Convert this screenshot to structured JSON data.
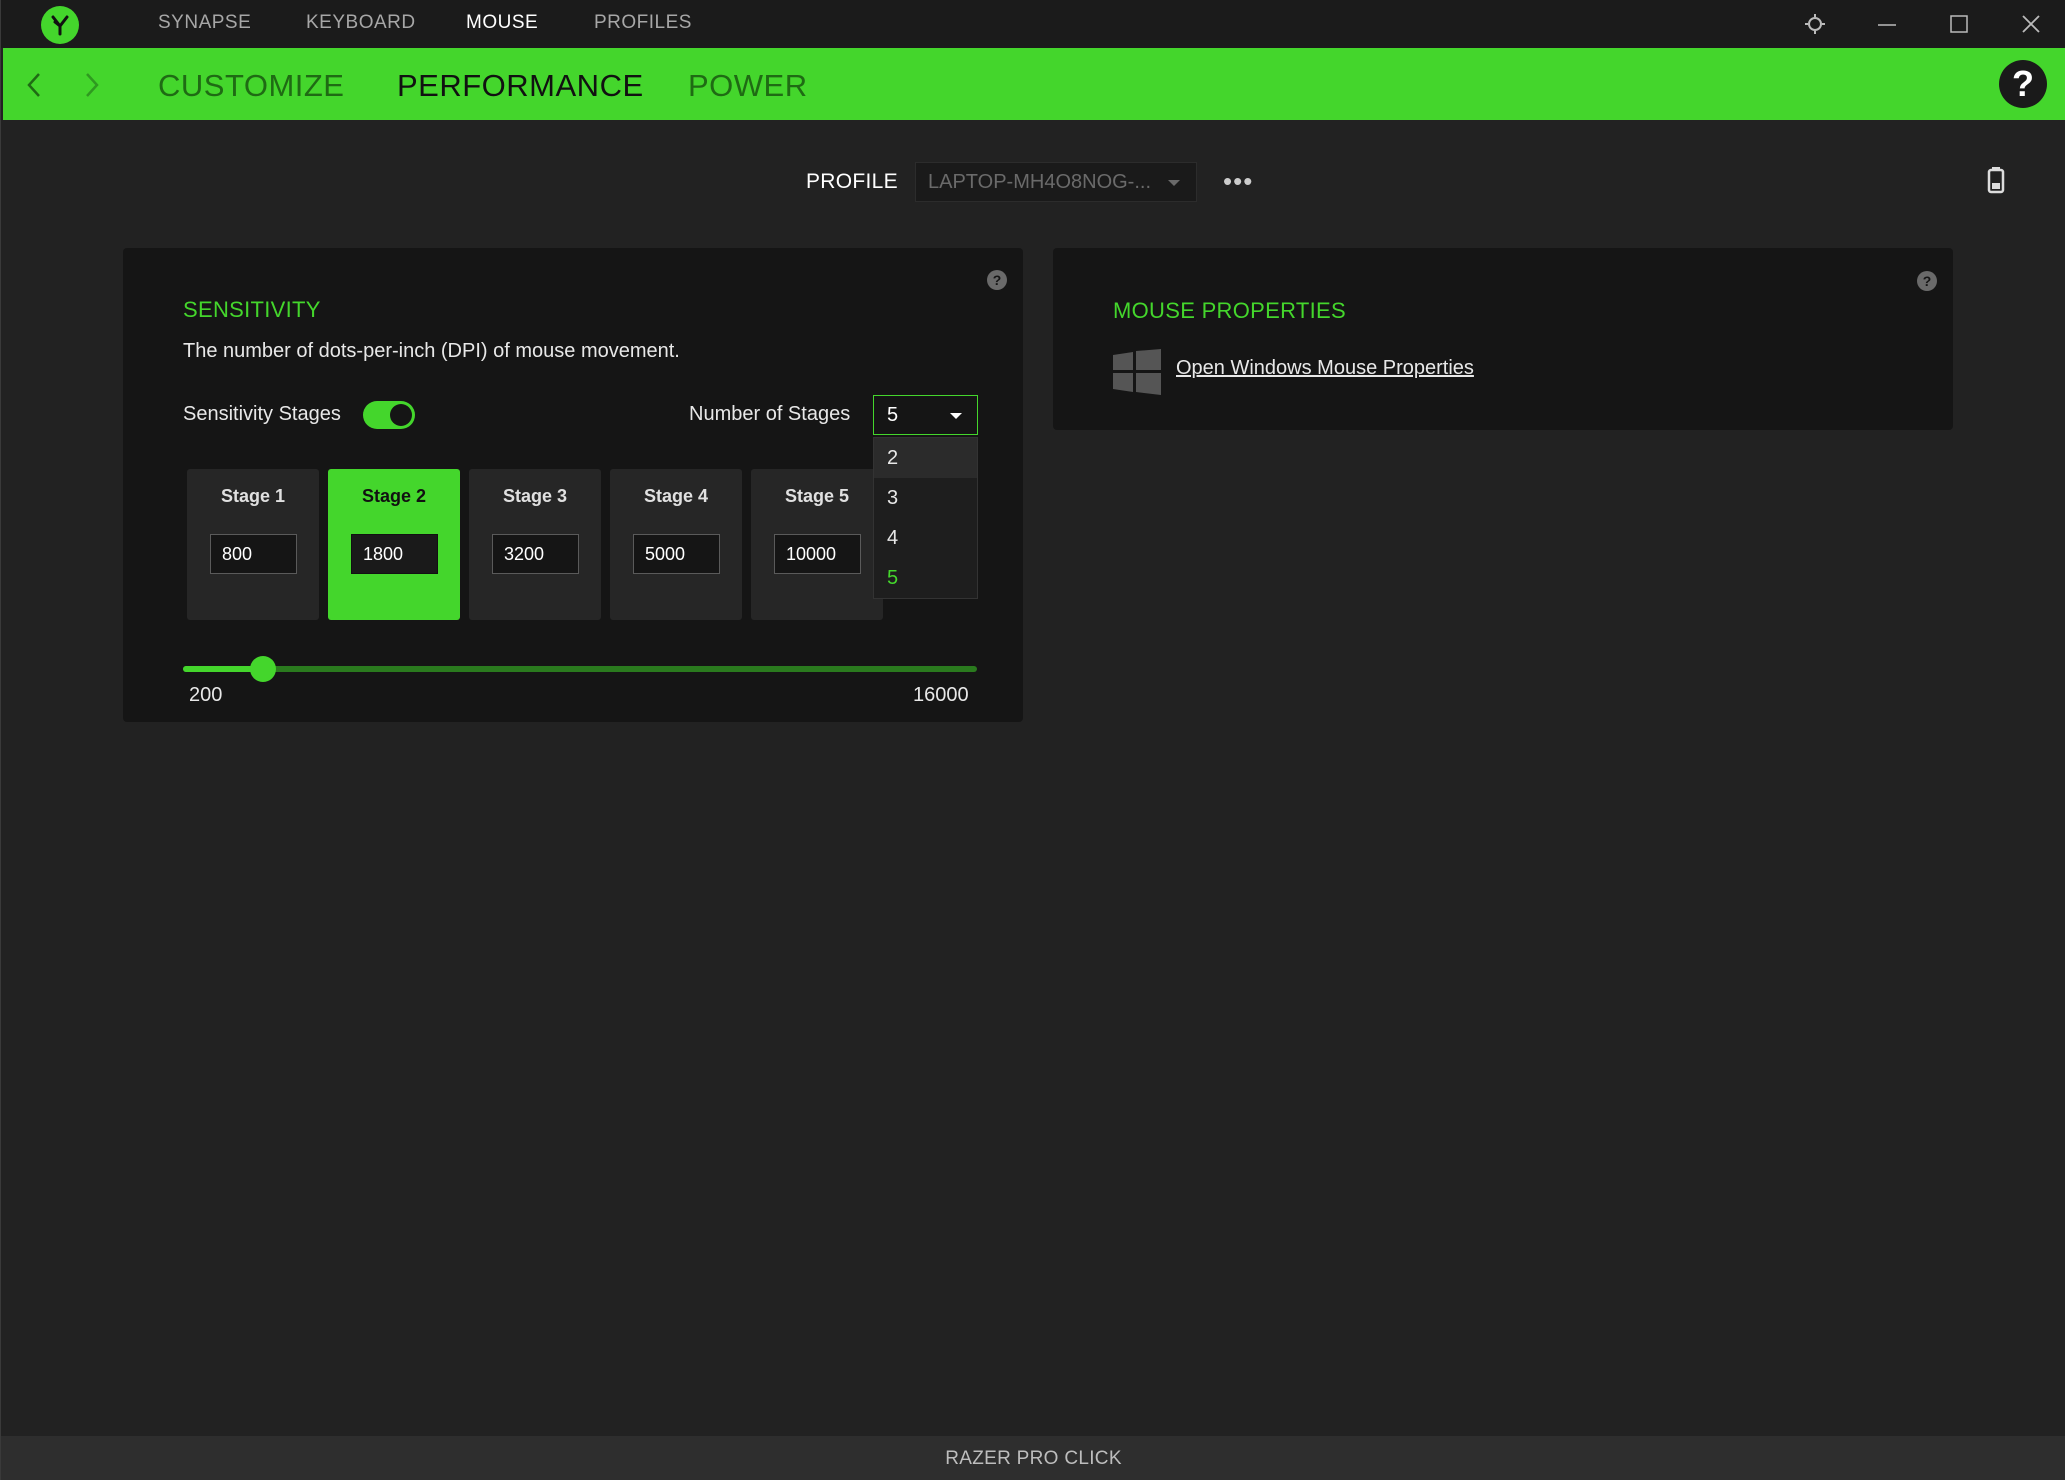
{
  "topnav": {
    "items": [
      "SYNAPSE",
      "KEYBOARD",
      "MOUSE",
      "PROFILES"
    ],
    "active": "MOUSE"
  },
  "window_controls": [
    "settings-icon",
    "minimize-icon",
    "maximize-icon",
    "close-icon"
  ],
  "subnav": {
    "tabs": [
      "CUSTOMIZE",
      "PERFORMANCE",
      "POWER"
    ],
    "active": "PERFORMANCE",
    "help": "?"
  },
  "profile": {
    "label": "PROFILE",
    "value": "LAPTOP-MH4O8NOG-...",
    "more": "•••"
  },
  "sensitivity": {
    "title": "SENSITIVITY",
    "description": "The number of dots-per-inch (DPI) of mouse movement.",
    "stages_label": "Sensitivity Stages",
    "stages_enabled": true,
    "number_of_stages_label": "Number of Stages",
    "number_of_stages_value": "5",
    "dropdown_options": [
      "2",
      "3",
      "4",
      "5"
    ],
    "dropdown_selected": "5",
    "stages": [
      {
        "label": "Stage 1",
        "value": "800"
      },
      {
        "label": "Stage 2",
        "value": "1800"
      },
      {
        "label": "Stage 3",
        "value": "3200"
      },
      {
        "label": "Stage 4",
        "value": "5000"
      },
      {
        "label": "Stage 5",
        "value": "10000"
      }
    ],
    "active_stage": "Stage 2",
    "slider_min": "200",
    "slider_max": "16000",
    "slider_value": 1800,
    "help": "?"
  },
  "mouse_properties": {
    "title": "MOUSE PROPERTIES",
    "link": "Open Windows Mouse Properties",
    "help": "?"
  },
  "footer": {
    "device": "RAZER PRO CLICK"
  },
  "colors": {
    "accent": "#44d62c",
    "background": "#222222",
    "panel": "#151515"
  }
}
